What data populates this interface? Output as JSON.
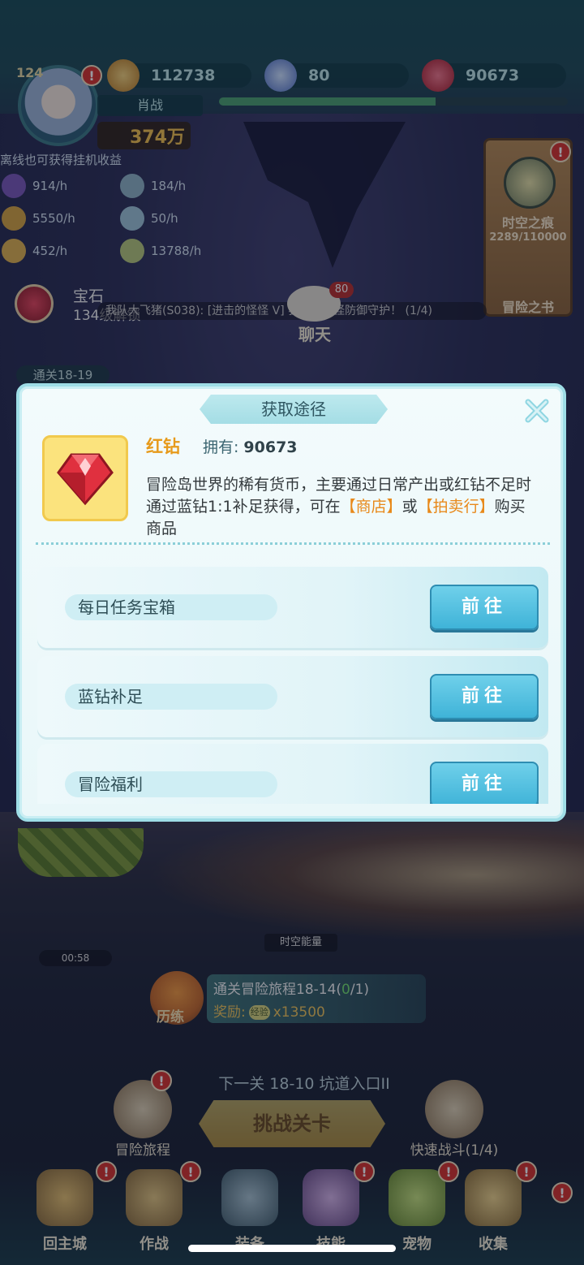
{
  "hud": {
    "level": "124",
    "player_name": "肖战",
    "xp_progress": 0.62,
    "resources": {
      "coin": "112738",
      "blue_diamond": "80",
      "red_diamond": "90673"
    },
    "combat_power": "374万",
    "idle_caption": "离线也可获得挂机收益",
    "idle_rates": [
      "914/h",
      "184/h",
      "5550/h",
      "50/h",
      "452/h",
      "13788/h"
    ],
    "side_book": {
      "title": "时空之痕",
      "progress": "2289/110000",
      "label": "冒险之书"
    },
    "gem_banner": {
      "title": "宝石",
      "subtitle": "134级解锁"
    },
    "chat": {
      "line": "我队大飞猪(S038): [进击的怪怪 V] 狙击！怪怪防御守护！ (1/4)",
      "button": "聊天",
      "count": "80"
    },
    "stage_tag": "通关18-19"
  },
  "battle": {
    "timer": "00:58",
    "energy": "时空能量",
    "quest": {
      "badge": "历练",
      "title_prefix": "通关冒险旅程18-14(",
      "progress_done": "0",
      "title_suffix": "/1)",
      "reward_label": "奖励:",
      "reward_icon_text": "经验",
      "reward_amount": "x13500"
    },
    "next_stage": "下一关 18-10 坑道入口II",
    "challenge_button": "挑战关卡",
    "left_button": "冒险旅程",
    "right_button": "快速战斗(1/4)"
  },
  "nav": {
    "items": [
      "回主城",
      "作战",
      "装备",
      "技能",
      "宠物",
      "收集"
    ]
  },
  "modal": {
    "title": "获取途径",
    "item_name": "红钻",
    "own_label": "拥有:",
    "own_value": "90673",
    "desc_main": "冒险岛世界的稀有货币，主要通过日常产出或红钻不足时通过蓝钻1:1补足获得，可在",
    "desc_shop": "【商店】",
    "desc_or": "或",
    "desc_auction": "【拍卖行】",
    "desc_end": "购买商品",
    "rows": [
      {
        "label": "每日任务宝箱",
        "button": "前往"
      },
      {
        "label": "蓝钻补足",
        "button": "前往"
      },
      {
        "label": "冒险福利",
        "button": "前往"
      }
    ]
  },
  "colors": {
    "accent": "#3fb3d8",
    "highlight": "#e8891a",
    "item_name": "#e79a1b"
  }
}
